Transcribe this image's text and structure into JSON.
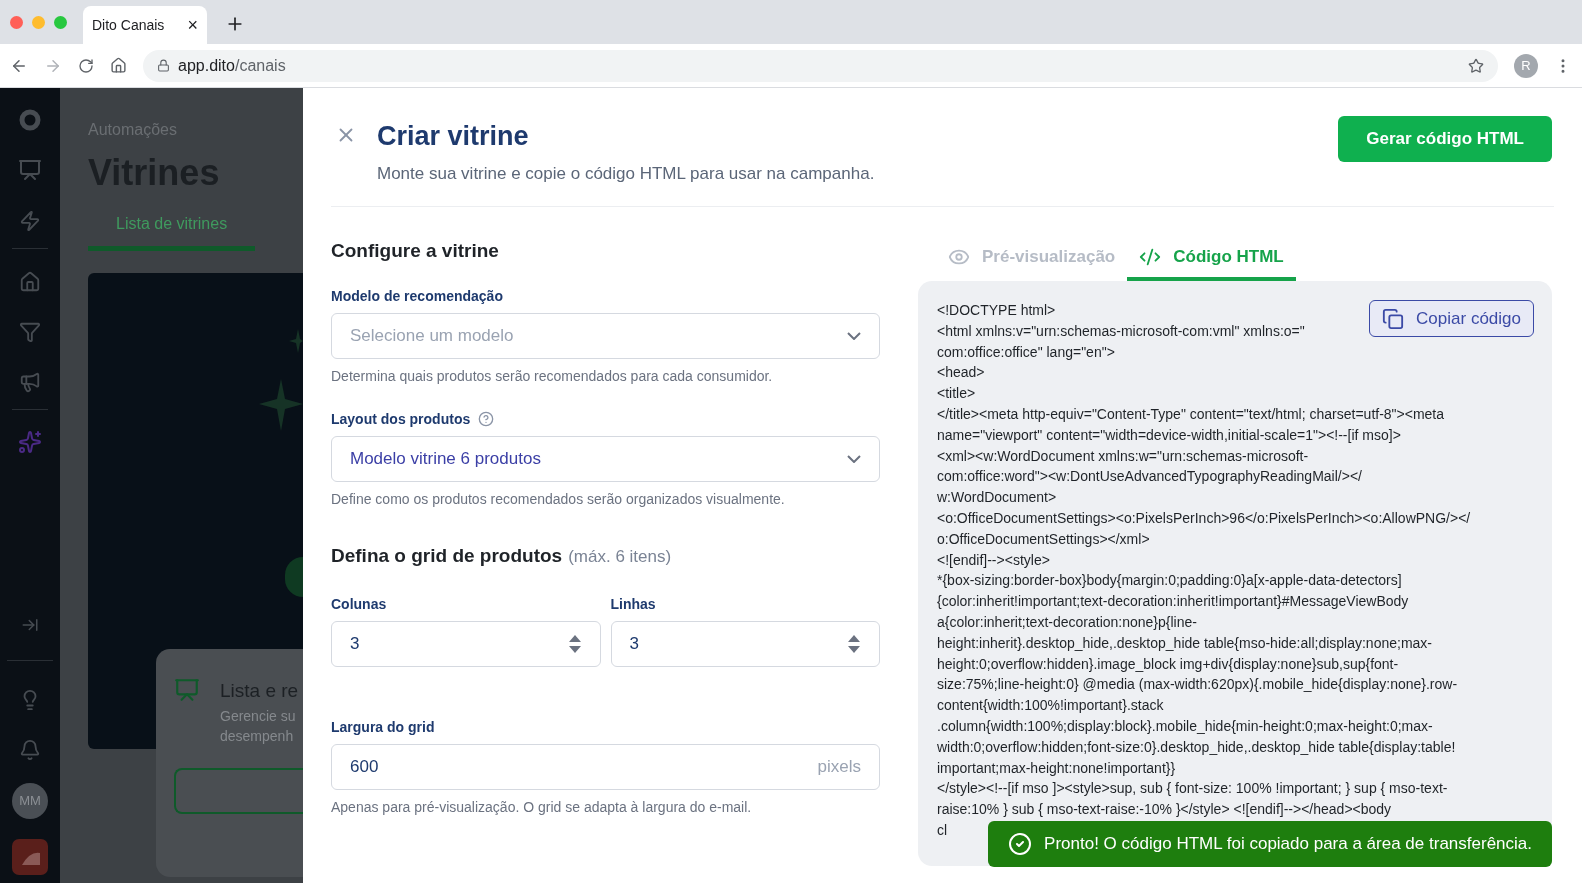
{
  "browser": {
    "tab_title": "Dito Canais",
    "close_tab": "×",
    "url_host": "app.dito",
    "url_path": "/canais",
    "profile": "R"
  },
  "sidebar": {
    "user_initials": "MM"
  },
  "background": {
    "breadcrumb": "Automações",
    "title": "Vitrines",
    "tabs": [
      {
        "label": "Lista de vitrines",
        "selected": true
      }
    ],
    "card_title": "Lista e re",
    "card_text": [
      "Gerencie su",
      "desempenh"
    ]
  },
  "modal": {
    "title": "Criar vitrine",
    "subtitle": "Monte sua vitrine e copie o código HTML para usar na campanha.",
    "primary_button": "Gerar código HTML",
    "section_title": "Configure a vitrine",
    "model_field": {
      "label": "Modelo de recomendação",
      "placeholder": "Selecione um modelo",
      "help": "Determina quais produtos serão recomendados para cada consumidor."
    },
    "layout_field": {
      "label": "Layout dos produtos",
      "value": "Modelo vitrine 6 produtos",
      "help": "Define como os produtos recomendados serão organizados visualmente."
    },
    "grid_title": "Defina o grid de produtos",
    "grid_note": "(máx. 6 itens)",
    "grid_fields": [
      {
        "label": "Colunas",
        "value": "3"
      },
      {
        "label": "Linhas",
        "value": "3"
      }
    ],
    "width_field": {
      "label": "Largura do grid",
      "value": "600",
      "suffix": "pixels",
      "help": "Apenas para pré-visualização. O grid se adapta à largura do e-mail."
    },
    "view_tabs": [
      {
        "kind": "preview",
        "label": "Pré-visualização",
        "selected": false
      },
      {
        "kind": "code",
        "label": "Código HTML",
        "selected": true
      }
    ],
    "copy_button": "Copiar código",
    "code_lines": [
      "<!DOCTYPE html>",
      "<html xmlns:v=\"urn:schemas-microsoft-com:vml\" xmlns:o=\"",
      "com:office:office\" lang=\"en\">",
      "<head>",
      "<title>",
      "</title><meta http-equiv=\"Content-Type\" content=\"text/html; charset=utf-8\"><meta",
      "name=\"viewport\" content=\"width=device-width,initial-scale=1\"><!--[if mso]>",
      "<xml><w:WordDocument xmlns:w=\"urn:schemas-microsoft-",
      "com:office:word\"><w:DontUseAdvancedTypographyReadingMail/></",
      "w:WordDocument>",
      "<o:OfficeDocumentSettings><o:PixelsPerInch>96</o:PixelsPerInch><o:AllowPNG/></",
      "o:OfficeDocumentSettings></xml>",
      "<![endif]--><style>",
      "*{box-sizing:border-box}body{margin:0;padding:0}a[x-apple-data-detectors]",
      "{color:inherit!important;text-decoration:inherit!important}#MessageViewBody",
      "a{color:inherit;text-decoration:none}p{line-",
      "height:inherit}.desktop_hide,.desktop_hide table{mso-hide:all;display:none;max-",
      "height:0;overflow:hidden}.image_block img+div{display:none}sub,sup{font-",
      "size:75%;line-height:0} @media (max-width:620px){.mobile_hide{display:none}.row-",
      "content{width:100%!important}.stack",
      ".column{width:100%;display:block}.mobile_hide{min-height:0;max-height:0;max-",
      "width:0;overflow:hidden;font-size:0}.desktop_hide,.desktop_hide table{display:table!",
      "important;max-height:none!important}}",
      "</style><!--[if mso ]><style>sup, sub { font-size: 100% !important; } sup { mso-text-",
      "raise:10% } sub { mso-text-raise:-10% }</style> <![endif]--></head><body",
      "cl"
    ],
    "toast": "Pronto! O código HTML foi copiado para a área de transferência."
  }
}
